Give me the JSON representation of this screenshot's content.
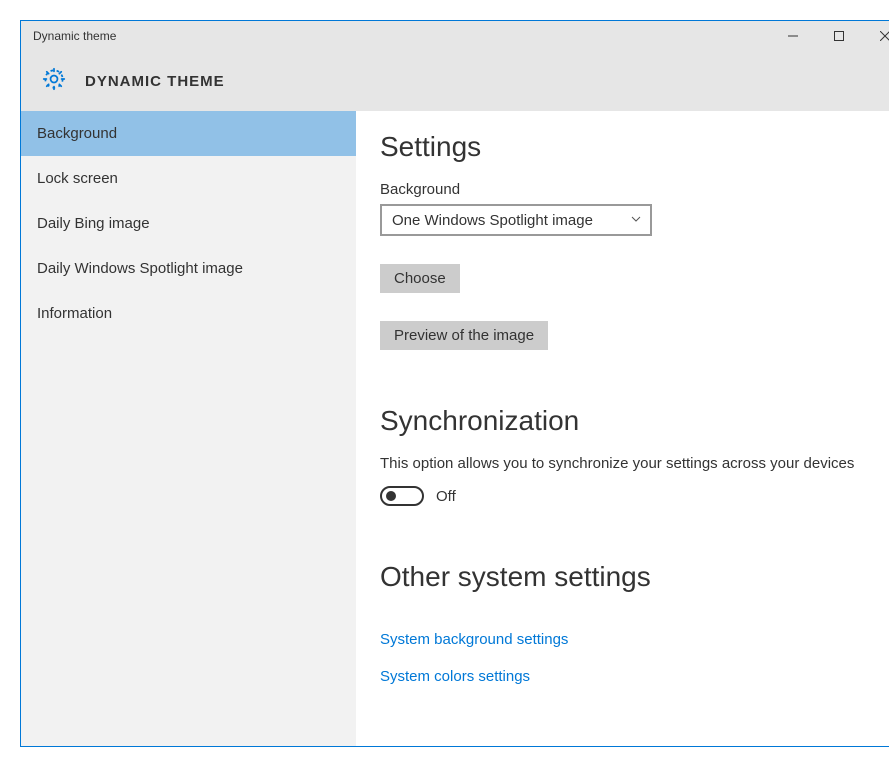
{
  "titlebar": {
    "title": "Dynamic theme"
  },
  "header": {
    "title": "DYNAMIC THEME"
  },
  "sidebar": {
    "items": [
      {
        "label": "Background",
        "selected": true
      },
      {
        "label": "Lock screen",
        "selected": false
      },
      {
        "label": "Daily Bing image",
        "selected": false
      },
      {
        "label": "Daily Windows Spotlight image",
        "selected": false
      },
      {
        "label": "Information",
        "selected": false
      }
    ]
  },
  "content": {
    "settings_heading": "Settings",
    "background_label": "Background",
    "dropdown_value": "One Windows Spotlight image",
    "choose_button": "Choose",
    "preview_button": "Preview of the image",
    "sync_heading": "Synchronization",
    "sync_desc": "This option allows you to synchronize your settings across your devices",
    "sync_toggle_state": "Off",
    "other_heading": "Other system settings",
    "link_background": "System background settings",
    "link_colors": "System colors settings"
  }
}
